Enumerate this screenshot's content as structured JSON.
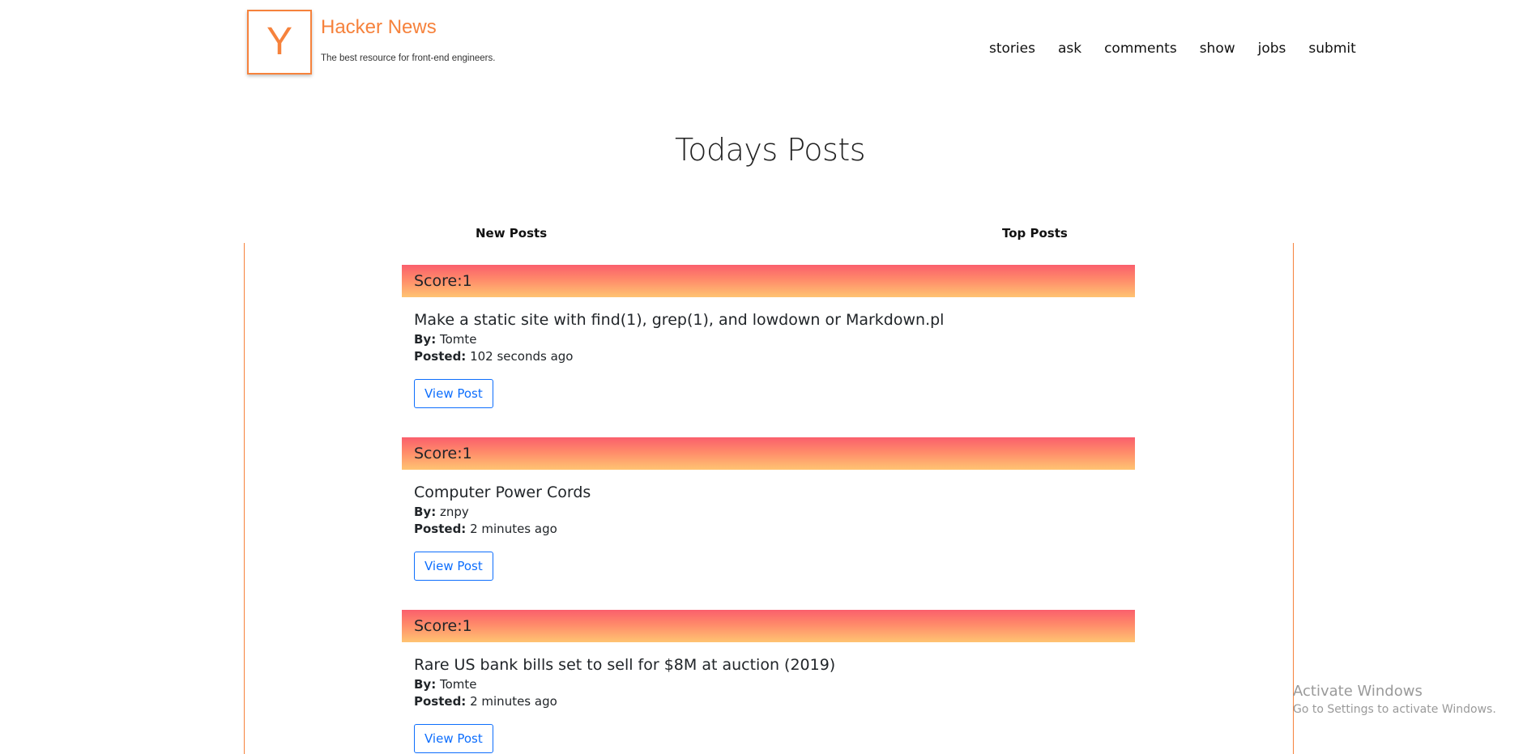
{
  "brand": {
    "logo_letter": "Y",
    "title": "Hacker News",
    "subtitle": "The best resource for front-end engineers."
  },
  "nav": {
    "items": [
      "stories",
      "ask",
      "comments",
      "show",
      "jobs",
      "submit"
    ]
  },
  "page": {
    "title": "Todays Posts"
  },
  "tabs": {
    "new": "New Posts",
    "top": "Top Posts"
  },
  "labels": {
    "score_prefix": "Score: ",
    "by": "By:",
    "posted": "Posted:",
    "view_button": "View Post"
  },
  "posts": [
    {
      "score": "1",
      "title": "Make a static site with find(1), grep(1), and lowdown or Markdown.pl",
      "author": "Tomte",
      "posted": "102 seconds ago"
    },
    {
      "score": "1",
      "title": "Computer Power Cords",
      "author": "znpy",
      "posted": "2 minutes ago"
    },
    {
      "score": "1",
      "title": "Rare US bank bills set to sell for $8M at auction (2019)",
      "author": "Tomte",
      "posted": "2 minutes ago"
    }
  ],
  "watermark": {
    "title": "Activate Windows",
    "subtitle": "Go to Settings to activate Windows."
  },
  "colors": {
    "brand_orange": "#f6823c",
    "score_gradient_top": "#fa5f6c",
    "score_gradient_bottom": "#ffc472",
    "button_blue": "#0d6efd"
  }
}
